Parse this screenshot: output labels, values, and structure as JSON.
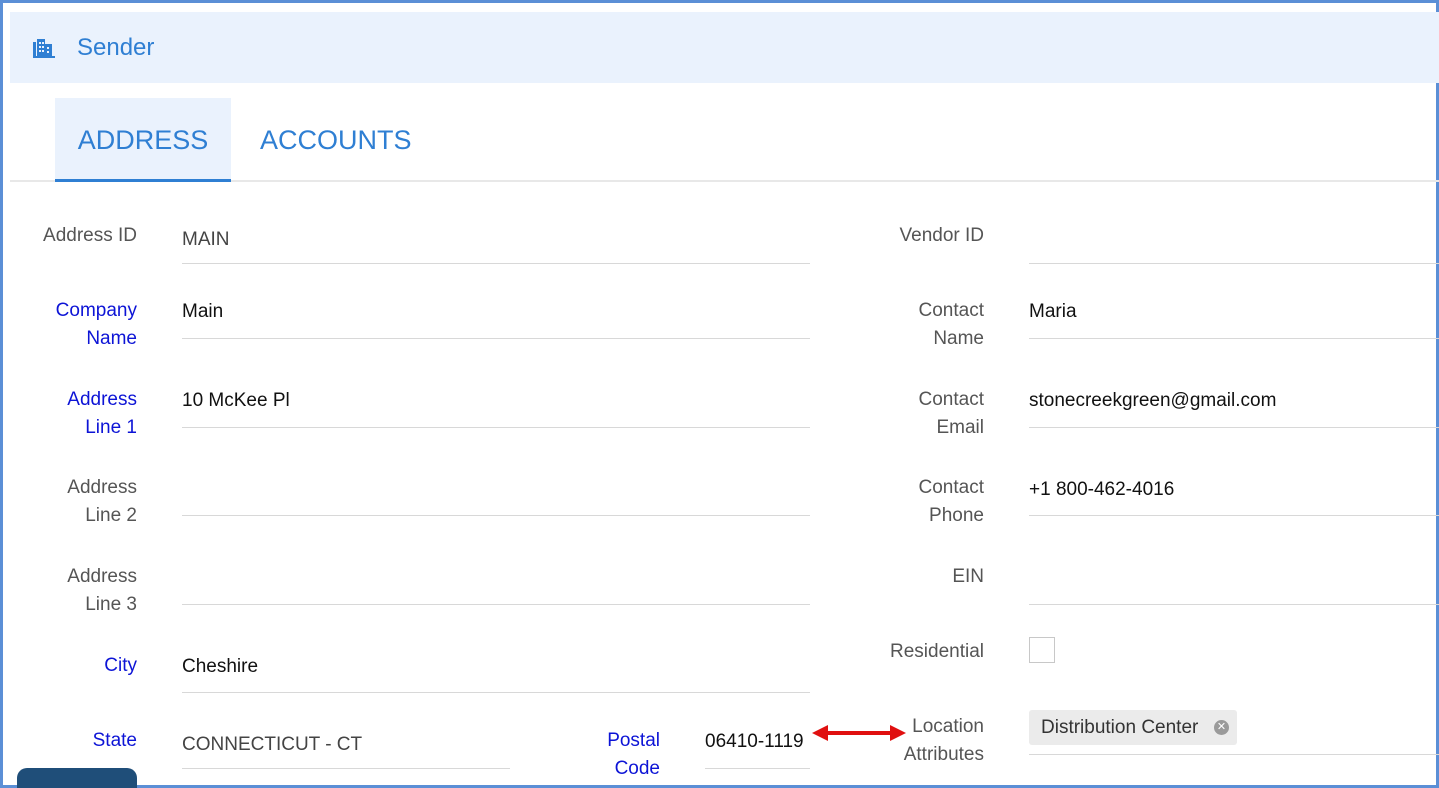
{
  "header": {
    "title": "Sender",
    "icon": "building-icon"
  },
  "tabs": [
    {
      "label": "ADDRESS",
      "active": true
    },
    {
      "label": "ACCOUNTS",
      "active": false
    }
  ],
  "left_fields": {
    "address_id": {
      "label": "Address ID",
      "value": "MAIN",
      "required": false
    },
    "company_name": {
      "label_line1": "Company",
      "label_line2": "Name",
      "value": "Main",
      "required": true
    },
    "address_line1": {
      "label_line1": "Address",
      "label_line2": "Line 1",
      "value": "10 McKee Pl",
      "required": true
    },
    "address_line2": {
      "label_line1": "Address",
      "label_line2": "Line 2",
      "value": "",
      "required": false
    },
    "address_line3": {
      "label_line1": "Address",
      "label_line2": "Line 3",
      "value": "",
      "required": false
    },
    "city": {
      "label": "City",
      "value": "Cheshire",
      "required": true
    },
    "state": {
      "label": "State",
      "value": "CONNECTICUT - CT",
      "required": true
    },
    "postal_code": {
      "label_line1": "Postal",
      "label_line2": "Code",
      "value": "06410-1119",
      "required": true
    }
  },
  "right_fields": {
    "vendor_id": {
      "label": "Vendor ID",
      "value": ""
    },
    "contact_name": {
      "label_line1": "Contact",
      "label_line2": "Name",
      "value": "Maria"
    },
    "contact_email": {
      "label_line1": "Contact",
      "label_line2": "Email",
      "value": "stonecreekgreen@gmail.com"
    },
    "contact_phone": {
      "label_line1": "Contact",
      "label_line2": "Phone",
      "value": "+1 800-462-4016"
    },
    "ein": {
      "label": "EIN",
      "value": ""
    },
    "residential": {
      "label": "Residential",
      "checked": false
    },
    "location_attributes": {
      "label_line1": "Location",
      "label_line2": "Attributes",
      "chips": [
        "Distribution Center"
      ]
    }
  },
  "colors": {
    "accent": "#2f7fd3",
    "required_label": "#0d14d6",
    "header_bg": "#eaf2fd",
    "annotation_arrow": "#e01010"
  }
}
